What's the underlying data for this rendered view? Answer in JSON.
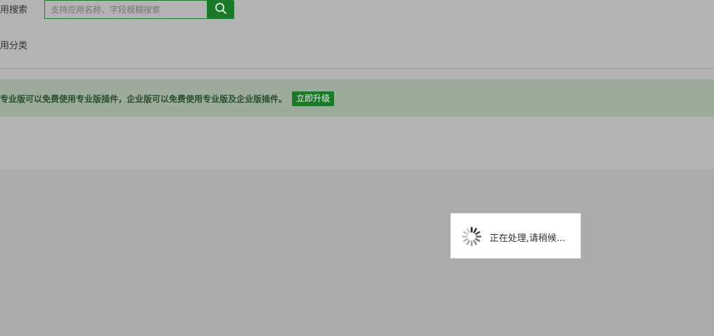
{
  "search": {
    "label": "用搜索",
    "placeholder": "支持应用名称、字段模糊搜索",
    "button_icon": "search-icon"
  },
  "category": {
    "label": "用分类"
  },
  "notice": {
    "text": "专业版可以免费使用专业版插件，企业版可以免费使用专业版及企业版插件。",
    "upgrade_label": "立即升级"
  },
  "loading": {
    "text": "正在处理,请稍候...",
    "icon": "spinner-icon"
  },
  "colors": {
    "accent_green": "#1a7a2a",
    "notice_bg": "#9dab9a",
    "notice_text": "#264f2a",
    "overlay": "#ababab"
  }
}
